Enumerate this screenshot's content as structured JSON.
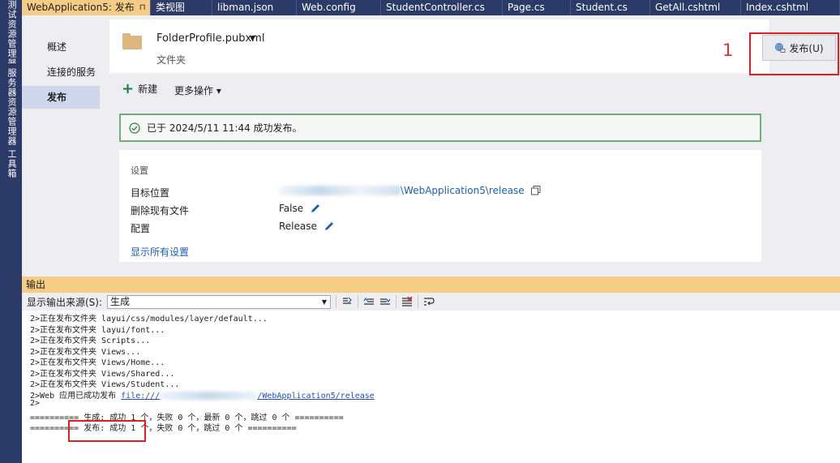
{
  "side_tabs": [
    "测试资源管理器",
    "服务器资源管理器",
    "工具箱"
  ],
  "doc_tabs": {
    "active": "WebApplication5: 发布",
    "active_pin": "⊓",
    "active_close": "✕",
    "others": [
      "类视图",
      "libman.json",
      "Web.config",
      "StudentController.cs",
      "Page.cs",
      "Student.cs",
      "GetAll.cshtml",
      "Index.cshtml"
    ]
  },
  "nav": {
    "overview": "概述",
    "connected_services": "连接的服务",
    "publish": "发布"
  },
  "profile": {
    "name": "FolderProfile.pubxml",
    "caret": "▼",
    "type": "文件夹"
  },
  "annotation_number": "1",
  "publish_button": "发布(U)",
  "actions": {
    "new": "新建",
    "more": "更多操作 ▾"
  },
  "status_message": "已于 2024/5/11 11:44 成功发布。",
  "settings": {
    "title": "设置",
    "target_label": "目标位置",
    "target_value": "\\WebApplication5\\release",
    "delete_label": "删除现有文件",
    "delete_value": "False",
    "config_label": "配置",
    "config_value": "Release",
    "show_all": "显示所有设置"
  },
  "output": {
    "title": "输出",
    "source_label": "显示输出来源(S):",
    "source_value": "生成",
    "lines": [
      "2>正在发布文件夹 layui/css/modules/layer/default...",
      "2>正在发布文件夹 layui/font...",
      "2>正在发布文件夹 Scripts...",
      "2>正在发布文件夹 Views...",
      "2>正在发布文件夹 Views/Home...",
      "2>正在发布文件夹 Views/Shared...",
      "2>正在发布文件夹 Views/Student..."
    ],
    "web_line_prefix": "2>Web 应用已成功发布 ",
    "web_line_link_start": "file:///",
    "web_line_link_end": "/WebApplication5/release",
    "prompt_line": "2>",
    "build_summary": "========== 生成: 成功 1 个，失败 0 个，最新 0 个，跳过 0 个 ==========",
    "publish_summary": "========== 发布: 成功 1 个，失败 0 个，跳过 0 个 =========="
  },
  "colors": {
    "accent_tab": "#f5cc84",
    "chrome_blue": "#2b3a67",
    "success_border": "#6fae76",
    "highlight_red": "#e02020",
    "link_blue": "#1a5fb4"
  }
}
